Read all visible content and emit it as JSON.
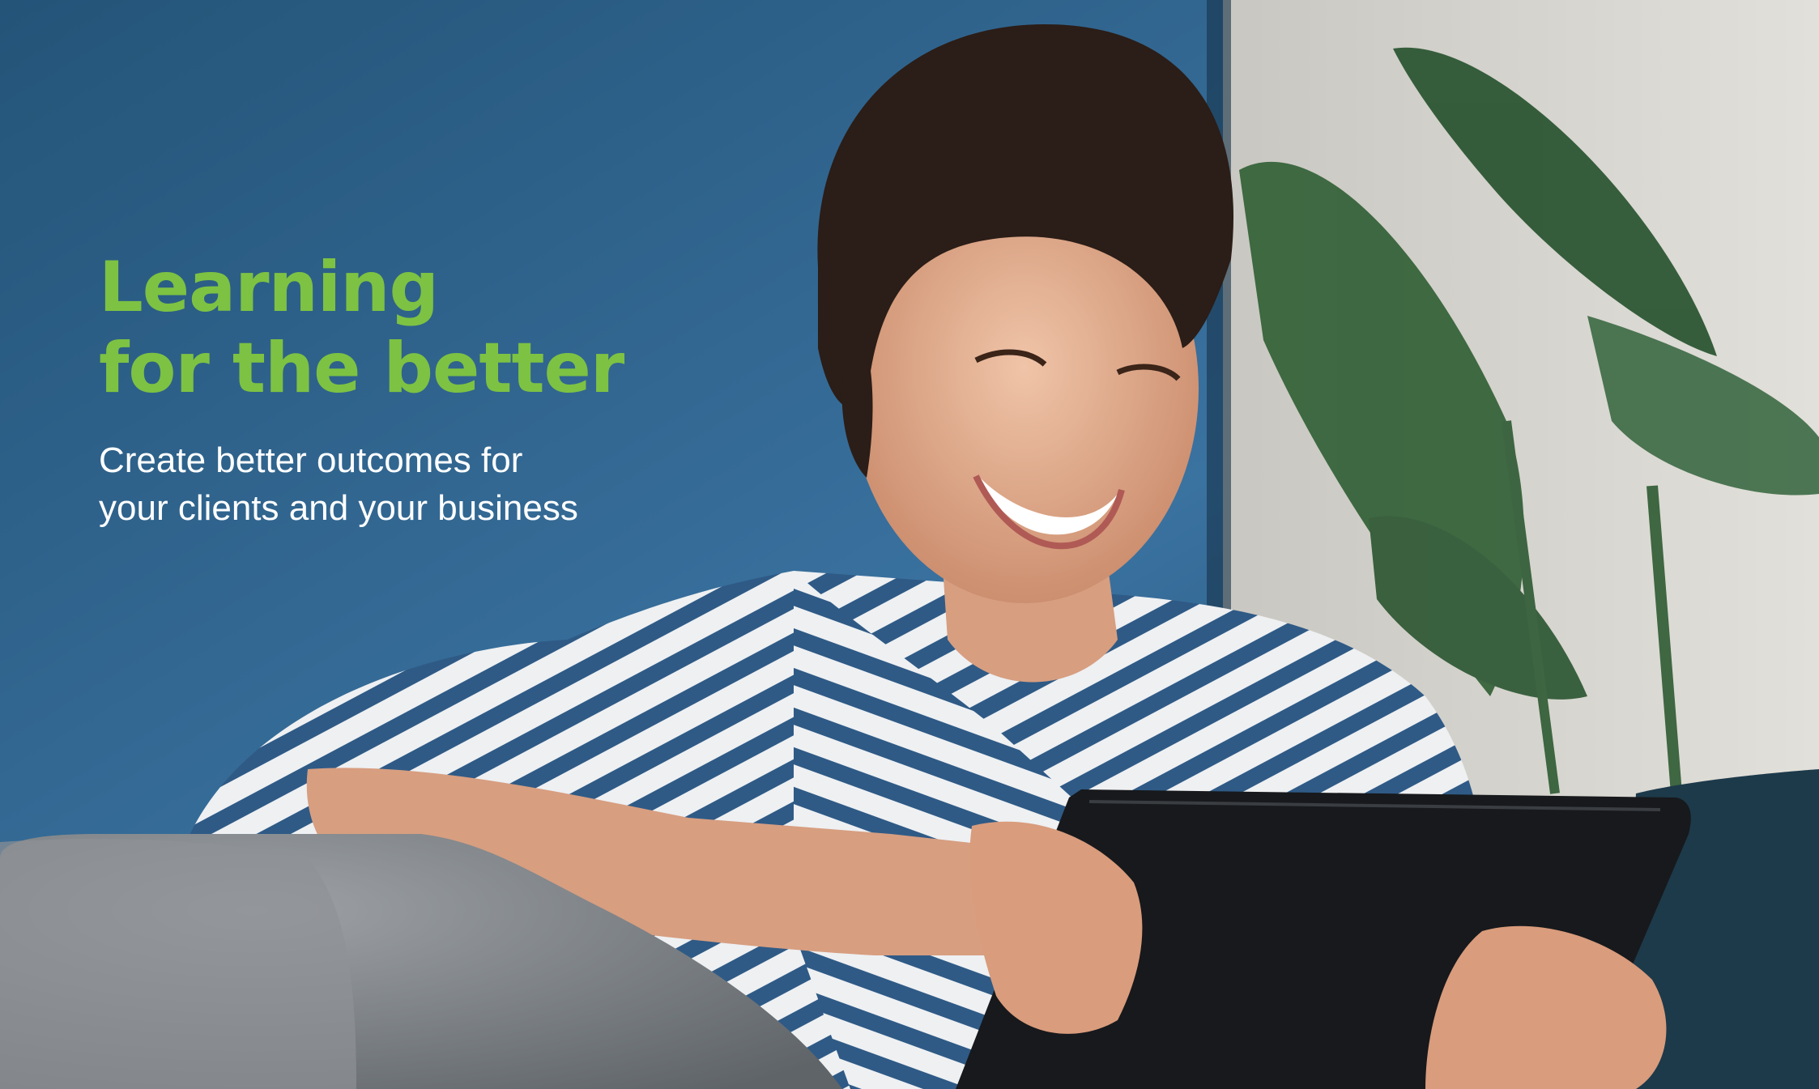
{
  "hero": {
    "headline_line1": "Learning",
    "headline_line2": "for the better",
    "subline_line1": "Create better outcomes for",
    "subline_line2": "your clients and your business"
  },
  "colors": {
    "headline": "#7dc242",
    "subline": "#ffffff",
    "wall_blue": "#2a5f87",
    "wall_light": "#d9d6cf"
  },
  "icons": [
    "hero-photo"
  ]
}
